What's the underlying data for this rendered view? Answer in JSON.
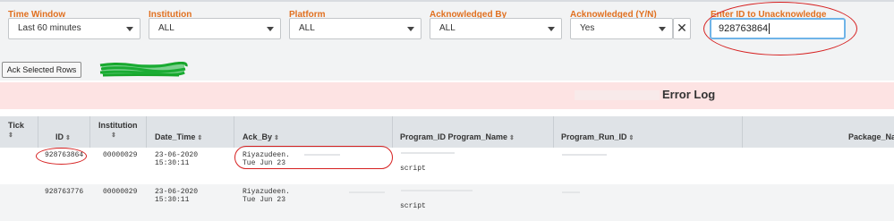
{
  "filters": {
    "time_window": {
      "label": "Time Window",
      "value": "Last 60 minutes"
    },
    "institution": {
      "label": "Institution",
      "value": "ALL"
    },
    "platform": {
      "label": "Platform",
      "value": "ALL"
    },
    "acknowledged_by": {
      "label": "Acknowledged By",
      "value": "ALL"
    },
    "acknowledged_yn": {
      "label": "Acknowledged (Y/N)",
      "value": "Yes",
      "clear": "✕"
    },
    "unack_id": {
      "label": "Enter ID to Unacknowledge",
      "value": "928763864"
    }
  },
  "actions": {
    "ack_selected": "Ack Selected Rows"
  },
  "panel": {
    "title": "Error Log"
  },
  "table": {
    "columns": [
      "Tick",
      "ID",
      "Institution",
      "Date_Time",
      "Ack_By",
      "Program_ID Program_Name",
      "Program_Run_ID",
      "Package_Na"
    ],
    "sort_glyph": "⇕",
    "rows": [
      {
        "id": "928763864",
        "institution": "00000029",
        "date": "23-06-2020",
        "time": "15:30:11",
        "ack_name": "Riyazudeen.",
        "ack_date": "Tue Jun 23",
        "program_name": "script"
      },
      {
        "id": "928763776",
        "institution": "00000029",
        "date": "23-06-2020",
        "time": "15:30:11",
        "ack_name": "Riyazudeen.",
        "ack_date": "Tue Jun 23",
        "program_name": "script"
      }
    ]
  },
  "colors": {
    "label_orange": "#e07020",
    "annotation_red": "#d62020",
    "panel_title_bg": "#fde3e3",
    "header_bg": "#dfe3e7",
    "input_focus": "#6fb4e8"
  }
}
